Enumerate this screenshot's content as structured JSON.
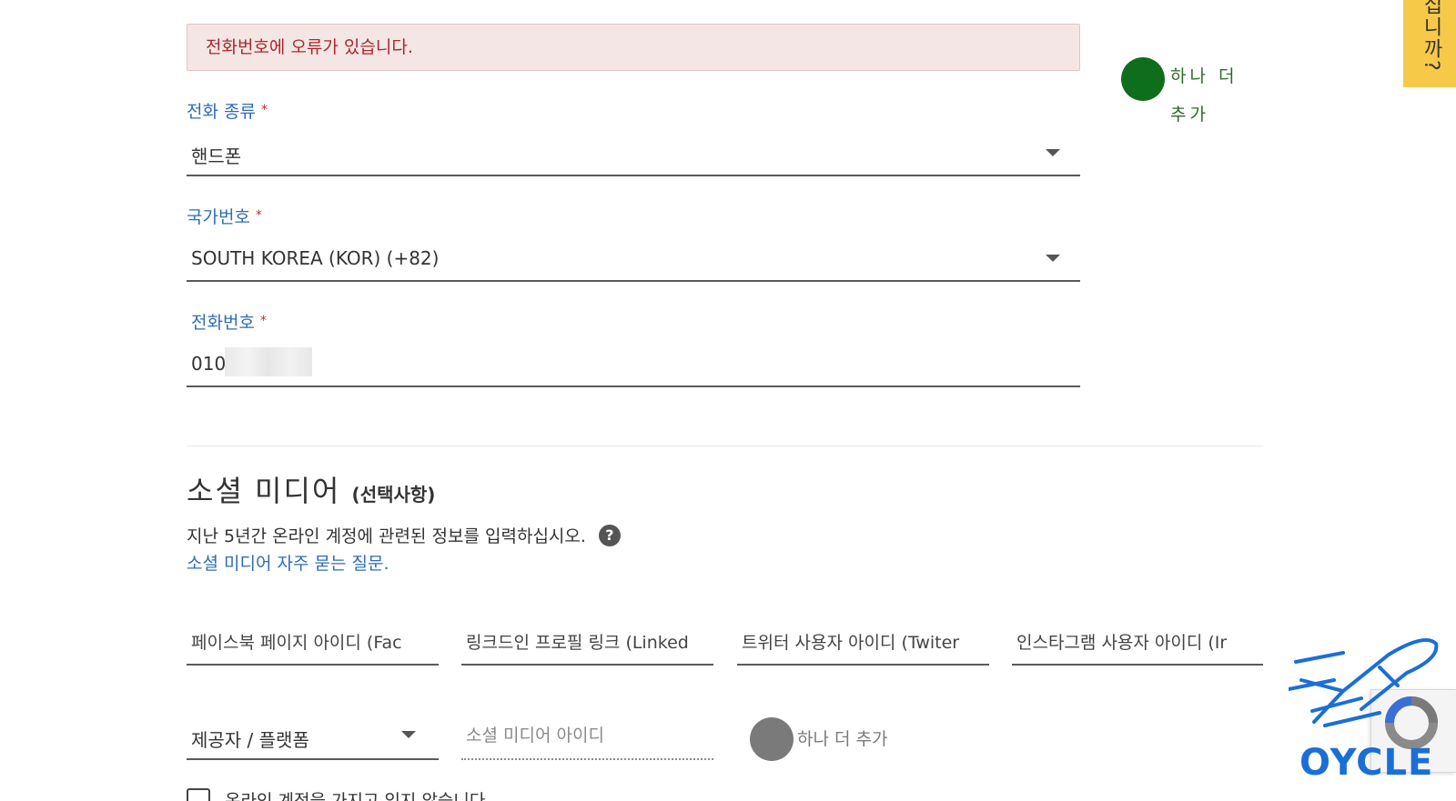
{
  "error_message": "전화번호에 오류가 있습니다.",
  "add_more_top": "하나 더 추가",
  "side_tab": "십니까?",
  "phone_type": {
    "label": "전화 종류",
    "required_mark": "*",
    "value": "핸드폰"
  },
  "country_code": {
    "label": "국가번호",
    "required_mark": "*",
    "value": "SOUTH KOREA (KOR) (+82)"
  },
  "phone_number": {
    "label": "전화번호",
    "required_mark": "*",
    "value": "010"
  },
  "social_media": {
    "title": "소셜 미디어",
    "optional": "(선택사항)",
    "description": "지난 5년간 온라인 계정에 관련된 정보를 입력하십시오.",
    "help_icon": "?",
    "faq_link": "소셜 미디어 자주 묻는 질문.",
    "fields": [
      "페이스북 페이지 아이디 (Fac",
      "링크드인 프로필 링크 (Linked",
      "트위터 사용자 아이디 (Twiter",
      "인스타그램 사용자 아이디 (Ir"
    ],
    "provider_select": "제공자 / 플랫폼",
    "sm_id_placeholder": "소셜 미디어 아이디",
    "add_more": "하나 더 추가",
    "no_account_checkbox": "온라인 계정을 가지고 있지 않습니다"
  },
  "watermark_text": "OYCLE",
  "colors": {
    "error_bg": "#f5e6e6",
    "error_text": "#a9282b",
    "label_blue": "#2f6db3",
    "required_red": "#c62828",
    "add_green": "#0e6e1c",
    "side_tab_yellow": "#f7c948",
    "watermark_blue": "#1a6fd6"
  },
  "icons": {
    "add_top": "plus-circle-icon",
    "add_bottom": "plus-circle-icon",
    "help": "question-circle-icon",
    "select": "caret-down-icon"
  }
}
